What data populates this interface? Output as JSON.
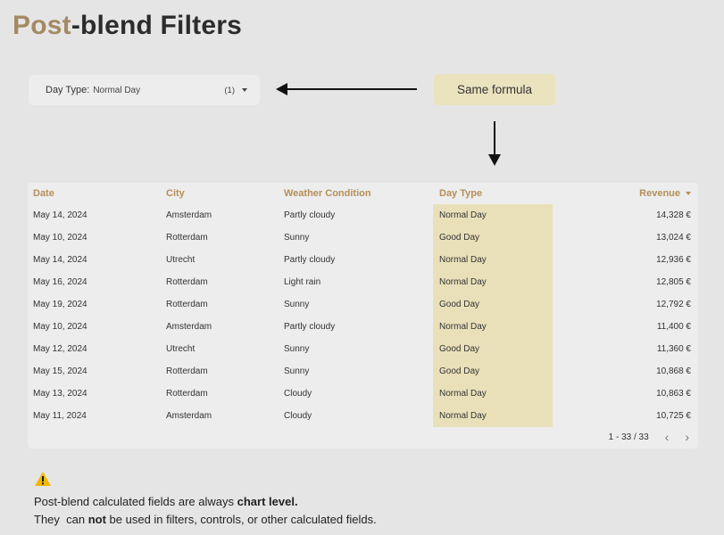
{
  "title": {
    "accent": "Post",
    "rest": "-blend Filters"
  },
  "filter": {
    "label": "Day Type:",
    "value": "Normal Day",
    "count": "(1)"
  },
  "formula_box": {
    "label": "Same formula"
  },
  "table": {
    "headers": {
      "date": "Date",
      "city": "City",
      "weather": "Weather Condition",
      "day_type": "Day Type",
      "revenue": "Revenue"
    },
    "rows": [
      {
        "date": "May 14, 2024",
        "city": "Amsterdam",
        "weather": "Partly cloudy",
        "day_type": "Normal Day",
        "revenue": "14,328 €"
      },
      {
        "date": "May 10, 2024",
        "city": "Rotterdam",
        "weather": "Sunny",
        "day_type": "Good Day",
        "revenue": "13,024 €"
      },
      {
        "date": "May 14, 2024",
        "city": "Utrecht",
        "weather": "Partly cloudy",
        "day_type": "Normal Day",
        "revenue": "12,936 €"
      },
      {
        "date": "May 16, 2024",
        "city": "Rotterdam",
        "weather": "Light rain",
        "day_type": "Normal Day",
        "revenue": "12,805 €"
      },
      {
        "date": "May 19, 2024",
        "city": "Rotterdam",
        "weather": "Sunny",
        "day_type": "Good Day",
        "revenue": "12,792 €"
      },
      {
        "date": "May 10, 2024",
        "city": "Amsterdam",
        "weather": "Partly cloudy",
        "day_type": "Normal Day",
        "revenue": "11,400 €"
      },
      {
        "date": "May 12, 2024",
        "city": "Utrecht",
        "weather": "Sunny",
        "day_type": "Good Day",
        "revenue": "11,360 €"
      },
      {
        "date": "May 15, 2024",
        "city": "Rotterdam",
        "weather": "Sunny",
        "day_type": "Good Day",
        "revenue": "10,868 €"
      },
      {
        "date": "May 13, 2024",
        "city": "Rotterdam",
        "weather": "Cloudy",
        "day_type": "Normal Day",
        "revenue": "10,863 €"
      },
      {
        "date": "May 11, 2024",
        "city": "Amsterdam",
        "weather": "Cloudy",
        "day_type": "Normal Day",
        "revenue": "10,725 €"
      }
    ],
    "pagination": "1 - 33 / 33"
  },
  "note": {
    "line1_start": "Post-blend calculated fields are always ",
    "line1_bold": "chart level.",
    "line2_start": "They  can ",
    "line2_bold": "not",
    "line2_end": " be used in filters, controls, or other calculated fields."
  },
  "icons": {
    "warning": "warning-icon",
    "prev": "chevron-left-icon",
    "next": "chevron-right-icon",
    "dropdown": "caret-down-icon"
  },
  "colors": {
    "accent": "#a48a63",
    "header": "#b58f59",
    "highlight": "#e9e0b9",
    "formula_box": "#ebe3be",
    "warning": "#f2b705"
  }
}
